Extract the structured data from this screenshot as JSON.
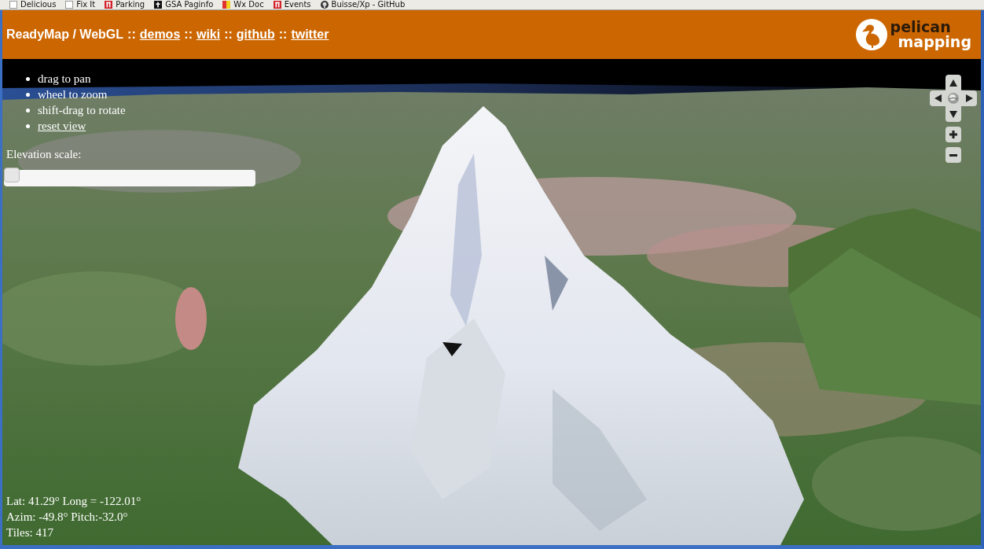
{
  "bookmarks": [
    {
      "label": "Delicious",
      "kind": "page"
    },
    {
      "label": "Fix It",
      "kind": "page"
    },
    {
      "label": "Parking",
      "kind": "marked"
    },
    {
      "label": "GSA Paginfo",
      "kind": "cross"
    },
    {
      "label": "Wx Doc",
      "kind": "striped"
    },
    {
      "label": "Events",
      "kind": "marked"
    },
    {
      "label": "Buisse/Xp - GitHub",
      "kind": "round"
    }
  ],
  "header": {
    "segments": [
      {
        "text": "ReadyMap / WebGL",
        "kind": "title"
      },
      {
        "text": "::",
        "kind": "separator"
      },
      {
        "text": "demos",
        "kind": "link"
      },
      {
        "text": "::",
        "kind": "separator"
      },
      {
        "text": "wiki",
        "kind": "link"
      },
      {
        "text": "::",
        "kind": "separator"
      },
      {
        "text": "github",
        "kind": "link"
      },
      {
        "text": "::",
        "kind": "separator"
      },
      {
        "text": "twitter",
        "kind": "link"
      }
    ],
    "logo": {
      "lines": [
        "pelican",
        "mapping"
      ]
    }
  },
  "instructions": [
    {
      "text": "drag to pan",
      "kind": "text"
    },
    {
      "text": "wheel to zoom",
      "kind": "text"
    },
    {
      "text": "shift-drag to rotate",
      "kind": "text"
    },
    {
      "text": "reset view",
      "kind": "link"
    }
  ],
  "elevation": {
    "label": "Elevation scale:",
    "level": 0
  },
  "status": [
    "Lat: 41.29° Long = -122.01°",
    "Azim: -49.8° Pitch:-32.0°",
    "Tiles: 417"
  ]
}
